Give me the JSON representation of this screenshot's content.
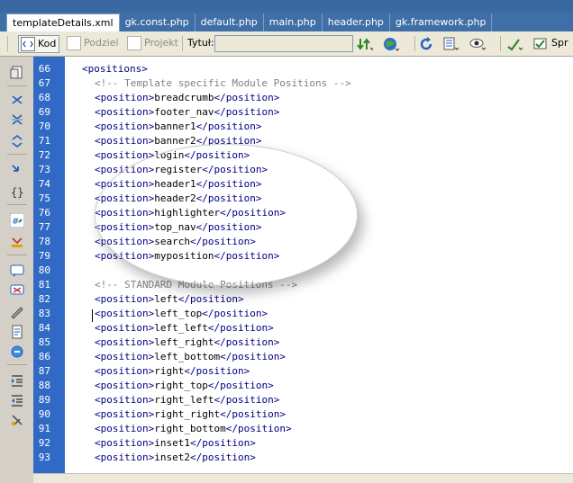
{
  "tabs": [
    {
      "label": "templateDetails.xml",
      "active": true
    },
    {
      "label": "gk.const.php",
      "active": false
    },
    {
      "label": "default.php",
      "active": false
    },
    {
      "label": "main.php",
      "active": false
    },
    {
      "label": "header.php",
      "active": false
    },
    {
      "label": "gk.framework.php",
      "active": false
    }
  ],
  "toolbar": {
    "kod_label": "Kod",
    "podziel_label": "Podziel",
    "projekt_label": "Projekt",
    "title_label": "Tytuł:",
    "title_value": "",
    "spr_label": "Spr"
  },
  "code_lines": [
    {
      "num": "66",
      "indent": 2,
      "text": "<positions>",
      "kind": "tag"
    },
    {
      "num": "67",
      "indent": 4,
      "text": "<!-- Template specific Module Positions -->",
      "kind": "comment"
    },
    {
      "num": "68",
      "indent": 4,
      "open": "<position>",
      "value": "breadcrumb",
      "close": "</position>",
      "kind": "pos"
    },
    {
      "num": "69",
      "indent": 4,
      "open": "<position>",
      "value": "footer_nav",
      "close": "</position>",
      "kind": "pos"
    },
    {
      "num": "70",
      "indent": 4,
      "open": "<position>",
      "value": "banner1",
      "close": "</position>",
      "kind": "pos"
    },
    {
      "num": "71",
      "indent": 4,
      "open": "<position>",
      "value": "banner2",
      "close": "</position>",
      "kind": "pos"
    },
    {
      "num": "72",
      "indent": 4,
      "open": "<position>",
      "value": "login",
      "close": "</position>",
      "kind": "pos"
    },
    {
      "num": "73",
      "indent": 4,
      "open": "<position>",
      "value": "register",
      "close": "</position>",
      "kind": "pos"
    },
    {
      "num": "74",
      "indent": 4,
      "open": "<position>",
      "value": "header1",
      "close": "</position>",
      "kind": "pos"
    },
    {
      "num": "75",
      "indent": 4,
      "open": "<position>",
      "value": "header2",
      "close": "</position>",
      "kind": "pos"
    },
    {
      "num": "76",
      "indent": 4,
      "open": "<position>",
      "value": "highlighter",
      "close": "</position>",
      "kind": "pos"
    },
    {
      "num": "77",
      "indent": 4,
      "open": "<position>",
      "value": "top_nav",
      "close": "</position>",
      "kind": "pos"
    },
    {
      "num": "78",
      "indent": 4,
      "open": "<position>",
      "value": "search",
      "close": "</position>",
      "kind": "pos"
    },
    {
      "num": "79",
      "indent": 4,
      "open": "<position>",
      "value": "myposition",
      "close": "</position>",
      "kind": "pos"
    },
    {
      "num": "80",
      "indent": 0,
      "text": "",
      "kind": "blank"
    },
    {
      "num": "81",
      "indent": 4,
      "text": "<!-- STANDARD Module Positions -->",
      "kind": "comment"
    },
    {
      "num": "82",
      "indent": 4,
      "open": "<position>",
      "value": "left",
      "close": "</position>",
      "kind": "pos"
    },
    {
      "num": "83",
      "indent": 4,
      "open": "<position>",
      "value": "left_top",
      "close": "</position>",
      "kind": "pos"
    },
    {
      "num": "84",
      "indent": 4,
      "open": "<position>",
      "value": "left_left",
      "close": "</position>",
      "kind": "pos"
    },
    {
      "num": "85",
      "indent": 4,
      "open": "<position>",
      "value": "left_right",
      "close": "</position>",
      "kind": "pos"
    },
    {
      "num": "86",
      "indent": 4,
      "open": "<position>",
      "value": "left_bottom",
      "close": "</position>",
      "kind": "pos"
    },
    {
      "num": "87",
      "indent": 4,
      "open": "<position>",
      "value": "right",
      "close": "</position>",
      "kind": "pos"
    },
    {
      "num": "88",
      "indent": 4,
      "open": "<position>",
      "value": "right_top",
      "close": "</position>",
      "kind": "pos"
    },
    {
      "num": "89",
      "indent": 4,
      "open": "<position>",
      "value": "right_left",
      "close": "</position>",
      "kind": "pos"
    },
    {
      "num": "90",
      "indent": 4,
      "open": "<position>",
      "value": "right_right",
      "close": "</position>",
      "kind": "pos"
    },
    {
      "num": "91",
      "indent": 4,
      "open": "<position>",
      "value": "right_bottom",
      "close": "</position>",
      "kind": "pos"
    },
    {
      "num": "92",
      "indent": 4,
      "open": "<position>",
      "value": "inset1",
      "close": "</position>",
      "kind": "pos"
    },
    {
      "num": "93",
      "indent": 4,
      "open": "<position>",
      "value": "inset2",
      "close": "</position>",
      "kind": "pos"
    }
  ],
  "colors": {
    "tab_bar": "#406fa8",
    "line_number_bg": "#316ac5",
    "tag": "#000080",
    "comment": "#808080"
  }
}
